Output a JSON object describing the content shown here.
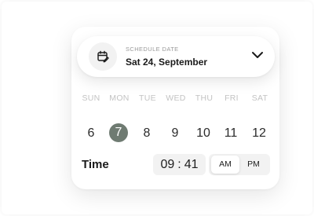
{
  "header": {
    "label": "SCHEDULE DATE",
    "value": "Sat 24, September",
    "icon": "calendar-edit-icon"
  },
  "weekdays": [
    "SUN",
    "MON",
    "TUE",
    "WED",
    "THU",
    "FRI",
    "SAT"
  ],
  "days": [
    "6",
    "7",
    "8",
    "9",
    "10",
    "11",
    "12"
  ],
  "selected_day": "7",
  "time": {
    "label": "Time",
    "hours": "09",
    "separator": ":",
    "minutes": "41",
    "am_label": "AM",
    "pm_label": "PM",
    "period": "AM"
  },
  "colors": {
    "selected_day_bg": "#6f7b72",
    "weekday_text": "#c3c3c3",
    "time_box_bg": "#f2f2f2"
  }
}
